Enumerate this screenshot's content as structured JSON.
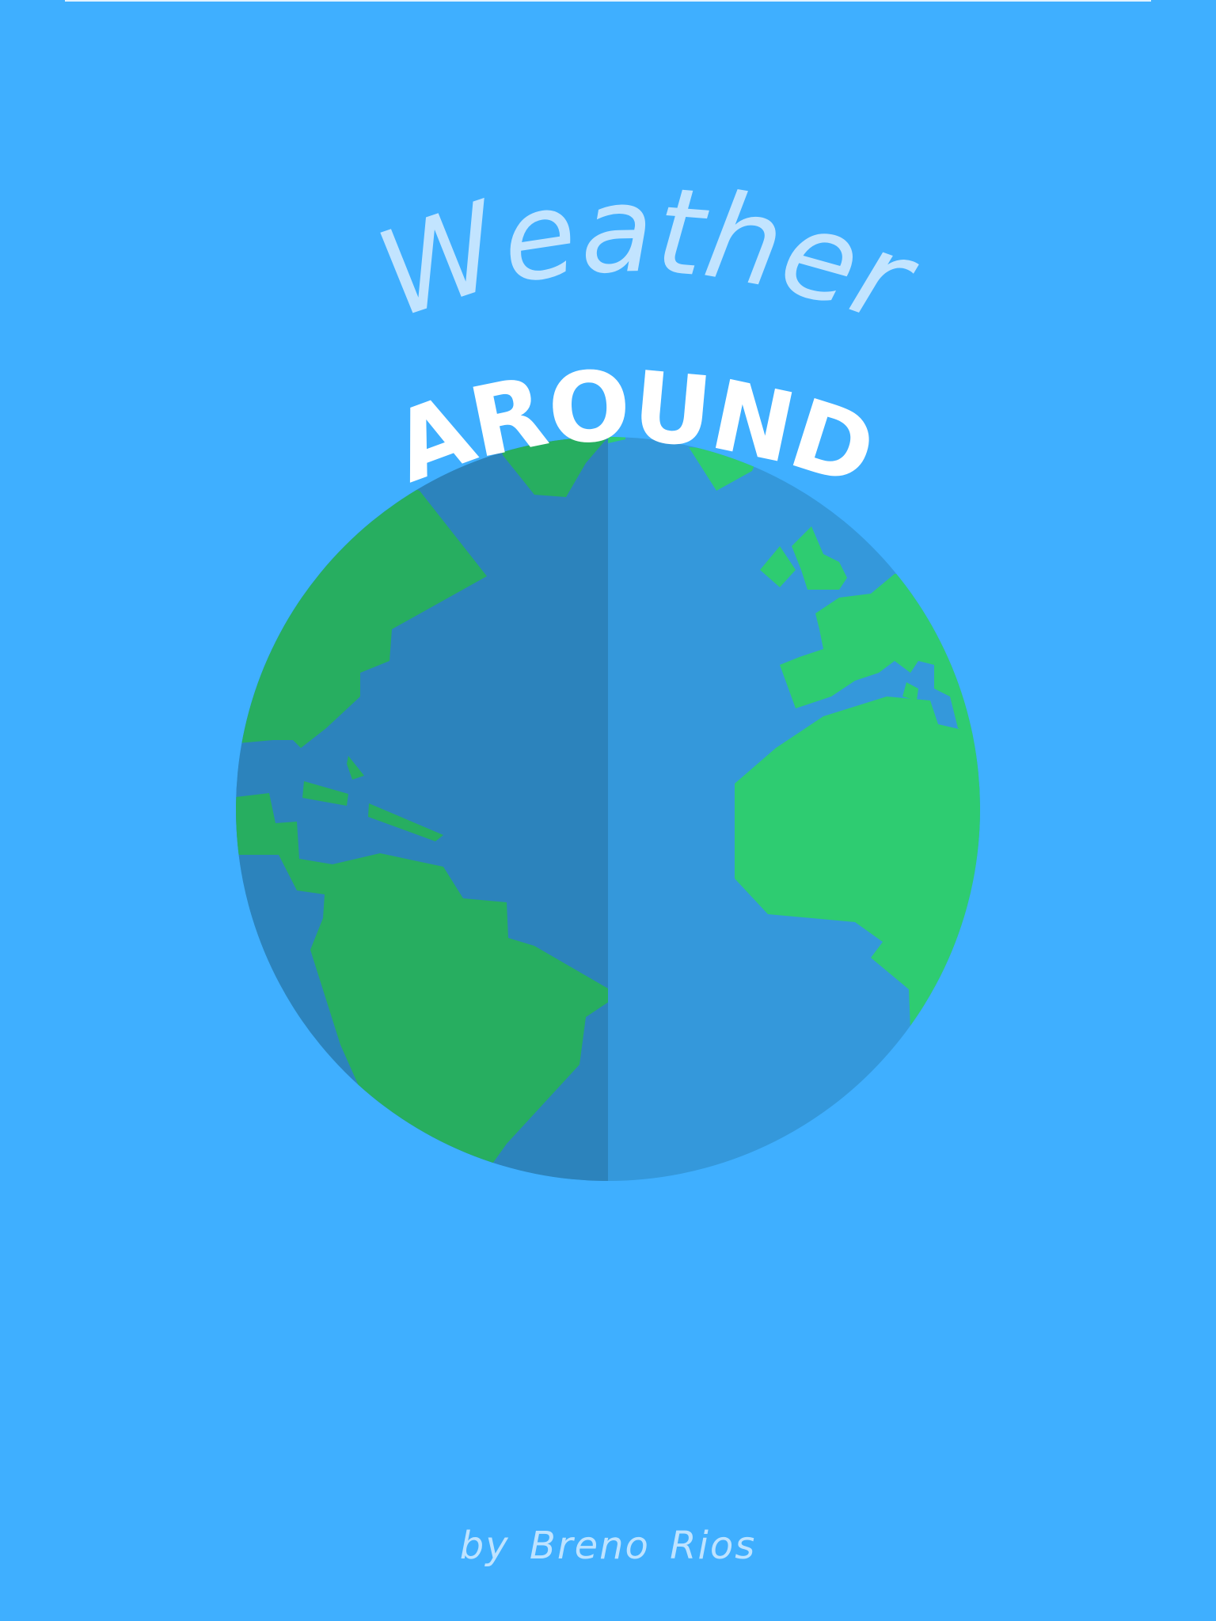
{
  "splash": {
    "title_line1": "Weather",
    "title_line2": "AROUND",
    "byline": "by  Breno Rios"
  },
  "colors": {
    "background": "#3FAFFF",
    "ocean_light": "#3498DB",
    "ocean_dark": "#2C83BC",
    "land_light": "#2ECC71",
    "land_dark": "#27AE60",
    "title_weather": "#C2E4FF",
    "title_around": "#FFFFFF",
    "byline": "#BEE3FF"
  },
  "icons": {
    "globe": "globe-icon"
  }
}
